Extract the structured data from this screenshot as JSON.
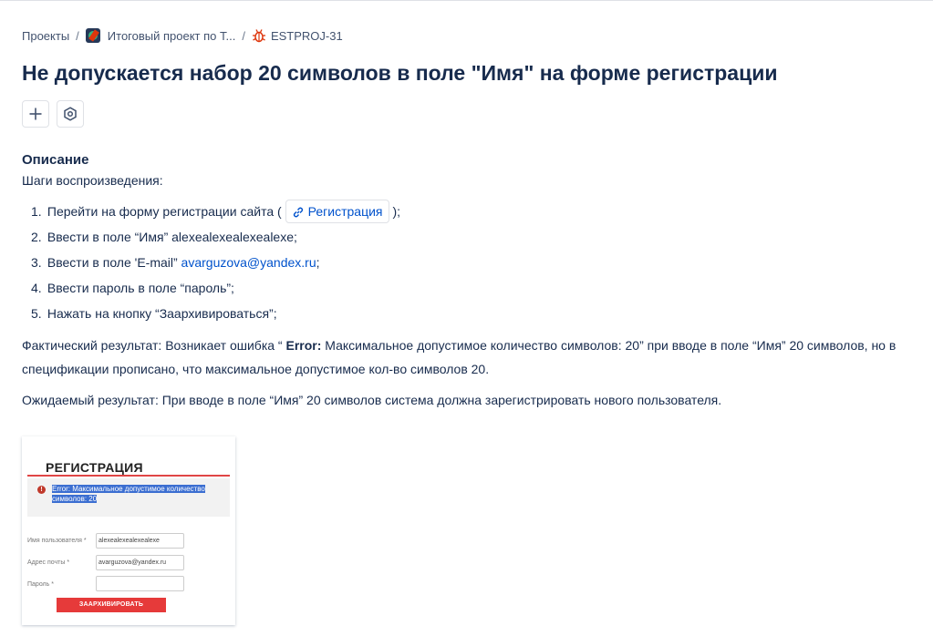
{
  "breadcrumb": {
    "projects": "Проекты",
    "separator": "/",
    "project": "Итоговый проект по Т...",
    "issue_key": "ESTPROJ-31"
  },
  "issue": {
    "title": "Не допускается набор 20 символов в поле \"Имя\" на форме регистрации"
  },
  "actions": {
    "add_icon": "plus-icon",
    "settings_icon": "hexagon-settings-icon"
  },
  "description": {
    "heading": "Описание",
    "steps_intro": "Шаги воспроизведения:",
    "steps": [
      {
        "num": "1.",
        "before": "Перейти на форму регистрации сайта (",
        "link": "Регистрация",
        "after": ");"
      },
      {
        "num": "2.",
        "text": "Ввести в поле “Имя” alexealexealexealexe;"
      },
      {
        "num": "3.",
        "before": "Ввести в поле 'E-mail” ",
        "email": "avarguzova@yandex.ru",
        "after": ";"
      },
      {
        "num": "4.",
        "text": "Ввести пароль в поле “пароль”;"
      },
      {
        "num": "5.",
        "text": "Нажать на кнопку “Заархивироваться”;"
      }
    ],
    "actual_prefix": "Фактический результат: Возникает ошибка “ ",
    "actual_bold": "Error:",
    "actual_rest": " Максимальное допустимое количество символов: 20” при вводе в поле “Имя” 20 символов, но в спецификации прописано, что максимальное допустимое кол-во символов 20.",
    "expected": "Ожидаемый результат: При вводе в поле “Имя” 20 символов система должна зарегистрировать нового пользователя."
  },
  "attachment": {
    "title": "РЕГИСТРАЦИЯ",
    "error_line1": "Error: Максимальное допустимое количество",
    "error_line2": "символов: 20",
    "fields": [
      {
        "label": "Имя пользователя *",
        "value": "alexealexealexealexe"
      },
      {
        "label": "Адрес почты *",
        "value": "avarguzova@yandex.ru"
      },
      {
        "label": "Пароль *",
        "value": ""
      }
    ],
    "button": "ЗААРХИВИРОВАТЬ"
  },
  "colors": {
    "link": "#0052cc",
    "text": "#172b4d",
    "bug": "#de350b"
  }
}
